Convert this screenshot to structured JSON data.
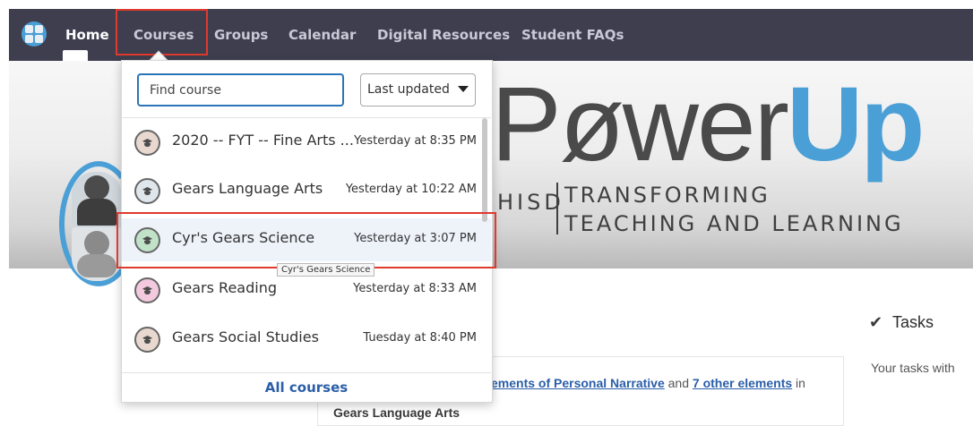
{
  "nav": {
    "items": [
      "Home",
      "Courses",
      "Groups",
      "Calendar",
      "Digital Resources",
      "Student FAQs"
    ]
  },
  "banner": {
    "power": "Pøwer",
    "up": "Up",
    "hisd": "HISD",
    "line1": "TRANSFORMING",
    "line2": "TEACHING AND LEARNING"
  },
  "dropdown": {
    "search_placeholder": "Find course",
    "sort_label": "Last updated",
    "courses": [
      {
        "name": "2020 -- FYT -- Fine Arts ...",
        "updated": "Yesterday at 8:35 PM",
        "color": "#e8d8d0"
      },
      {
        "name": "Gears Language Arts",
        "updated": "Yesterday at 10:22 AM",
        "color": "#dfe6ec"
      },
      {
        "name": "Cyr's Gears Science",
        "updated": "Yesterday at 3:07 PM",
        "color": "#bfe2c8"
      },
      {
        "name": "Gears Reading",
        "updated": "Yesterday at 8:33 AM",
        "color": "#f2c9de"
      },
      {
        "name": "Gears Social Studies",
        "updated": "Tuesday at 8:40 PM",
        "color": "#e8d8d0"
      }
    ],
    "tooltip": "Cyr's Gears Science",
    "all_courses": "All courses"
  },
  "tasks": {
    "title": "Tasks",
    "text": "Your tasks with"
  },
  "card": {
    "link1": "ements of Personal Narrative",
    "and": " and ",
    "link2": "7 other elements",
    "in": " in",
    "course": "Gears Language Arts"
  },
  "colors": {
    "nav_bg": "#3f3e4f",
    "accent_blue": "#4a9fd6",
    "highlight_red": "#e0392d",
    "link_blue": "#2a5ea8"
  }
}
